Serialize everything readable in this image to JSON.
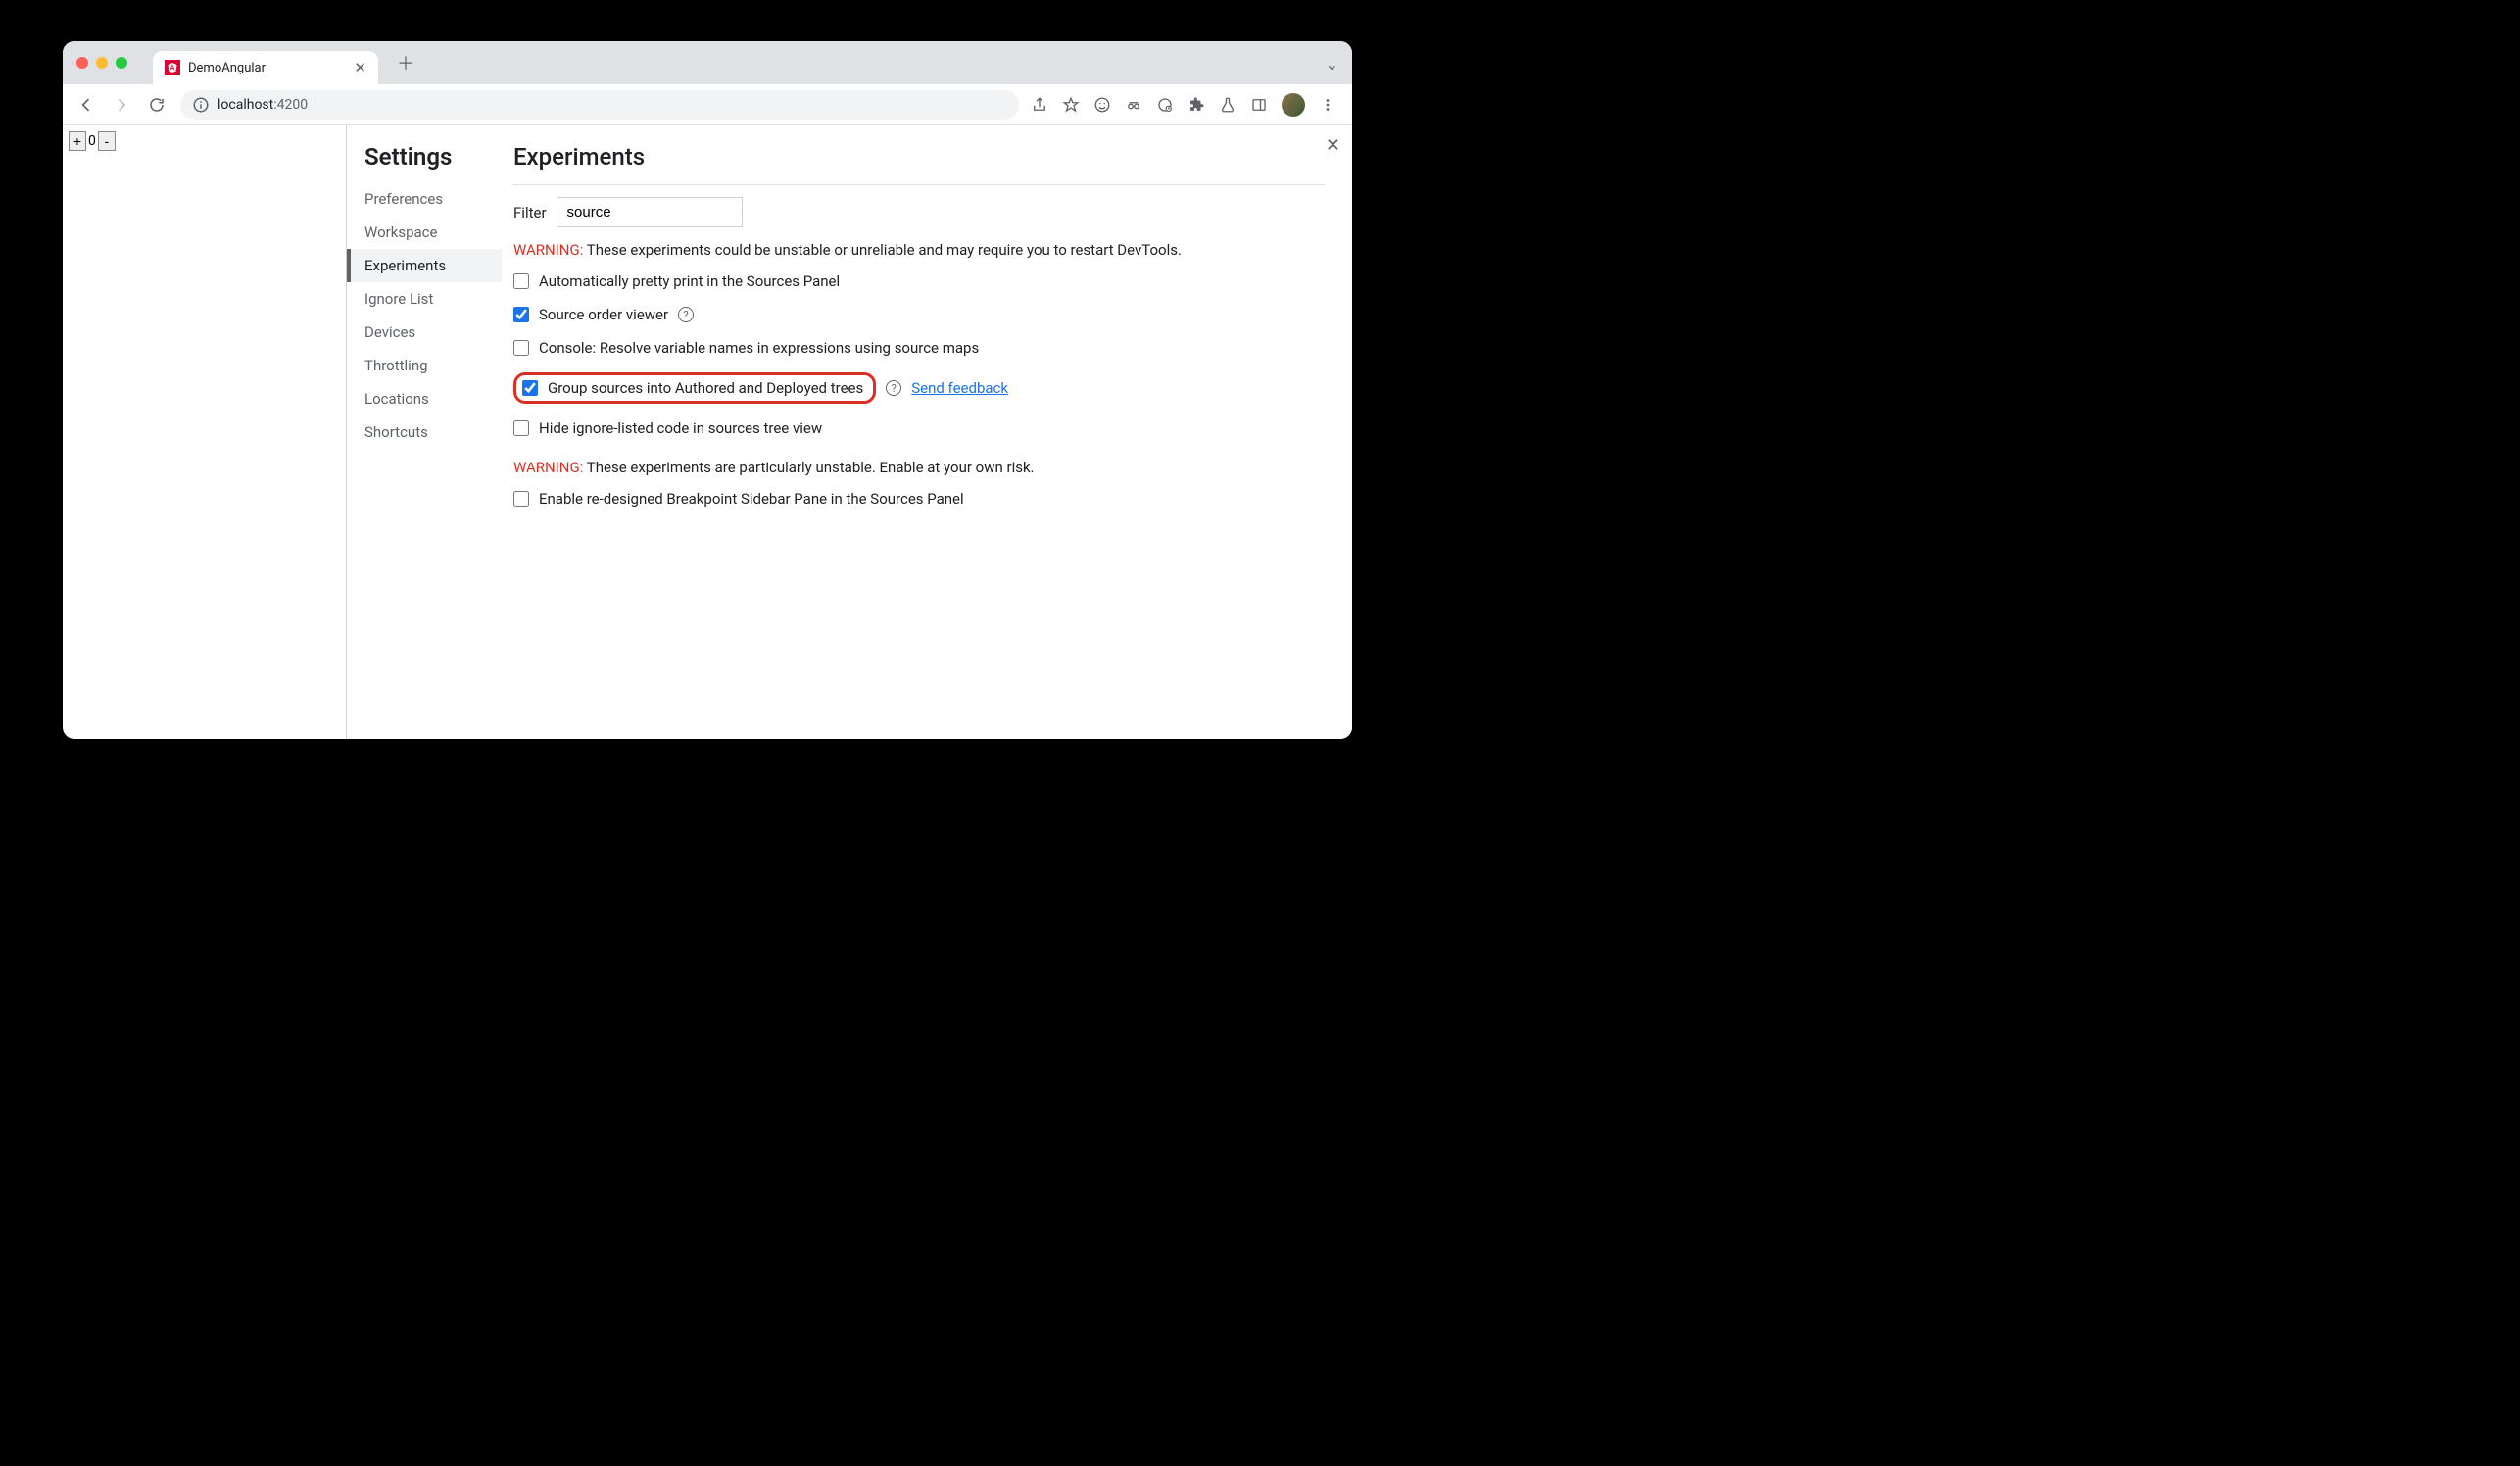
{
  "tab": {
    "title": "DemoAngular"
  },
  "omnibox": {
    "host": "localhost",
    "rest": ":4200"
  },
  "counter": {
    "plus": "+",
    "value": "0",
    "minus": "-"
  },
  "settings": {
    "title": "Settings",
    "nav": [
      {
        "label": "Preferences",
        "active": false
      },
      {
        "label": "Workspace",
        "active": false
      },
      {
        "label": "Experiments",
        "active": true
      },
      {
        "label": "Ignore List",
        "active": false
      },
      {
        "label": "Devices",
        "active": false
      },
      {
        "label": "Throttling",
        "active": false
      },
      {
        "label": "Locations",
        "active": false
      },
      {
        "label": "Shortcuts",
        "active": false
      }
    ]
  },
  "experiments": {
    "heading": "Experiments",
    "filter_label": "Filter",
    "filter_value": "source",
    "warning1_prefix": "WARNING:",
    "warning1_text": " These experiments could be unstable or unreliable and may require you to restart DevTools.",
    "items": [
      {
        "label": "Automatically pretty print in the Sources Panel",
        "checked": false,
        "help": false
      },
      {
        "label": "Source order viewer",
        "checked": true,
        "help": true
      },
      {
        "label": "Console: Resolve variable names in expressions using source maps",
        "checked": false,
        "help": false
      },
      {
        "label": "Group sources into Authored and Deployed trees",
        "checked": true,
        "help": true,
        "highlighted": true,
        "feedback": "Send feedback"
      },
      {
        "label": "Hide ignore-listed code in sources tree view",
        "checked": false,
        "help": false
      }
    ],
    "warning2_prefix": "WARNING:",
    "warning2_text": " These experiments are particularly unstable. Enable at your own risk.",
    "items2": [
      {
        "label": "Enable re-designed Breakpoint Sidebar Pane in the Sources Panel",
        "checked": false
      }
    ]
  }
}
